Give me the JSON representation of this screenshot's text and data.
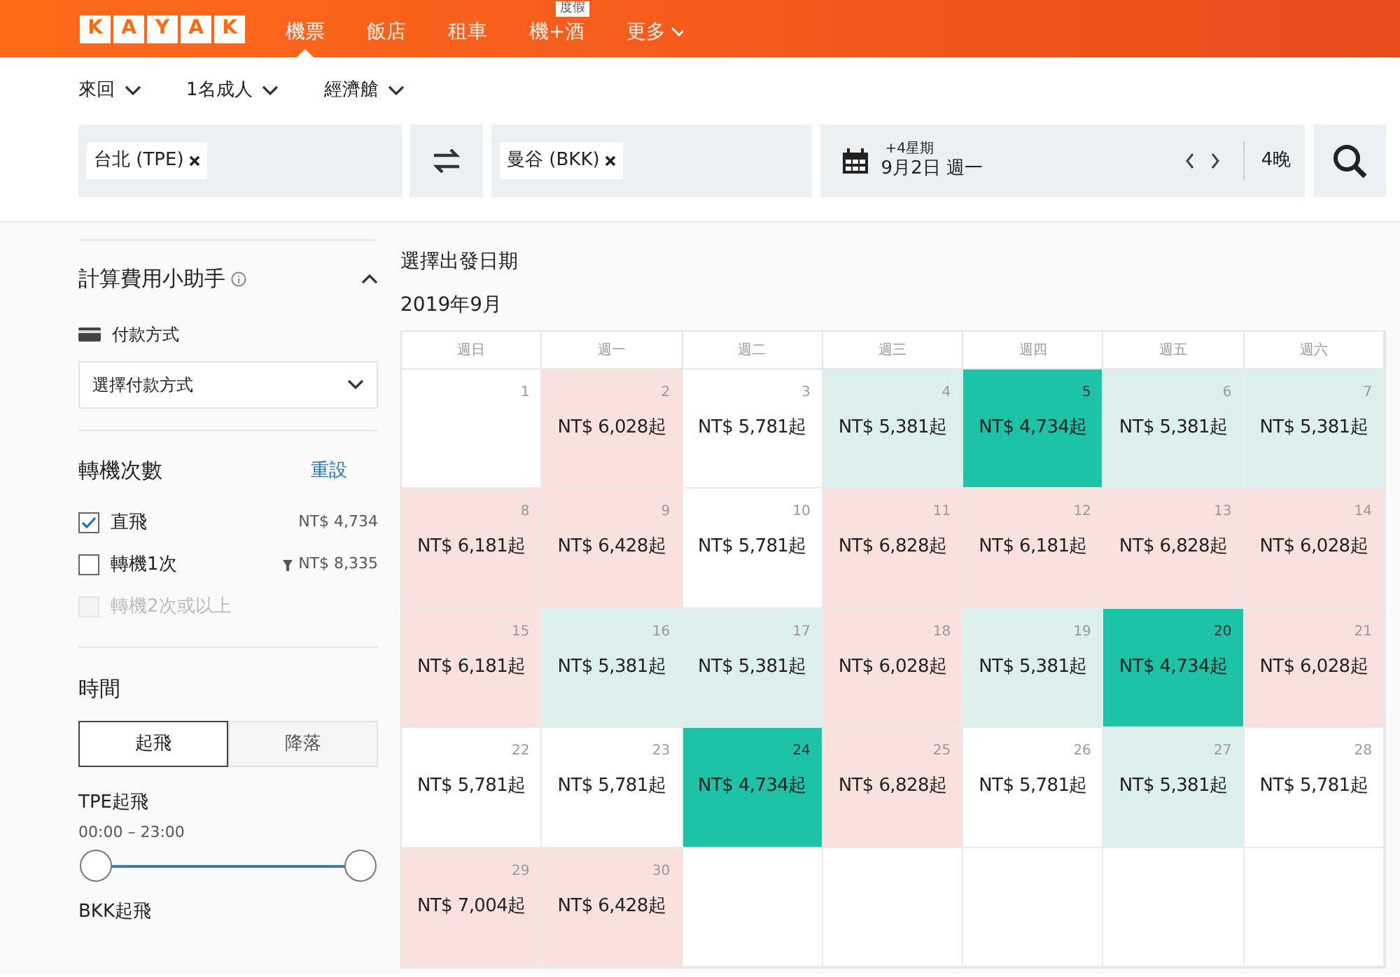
{
  "logo": [
    "K",
    "A",
    "Y",
    "A",
    "K"
  ],
  "nav": [
    {
      "label": "機票",
      "selected": true
    },
    {
      "label": "飯店",
      "selected": false
    },
    {
      "label": "租車",
      "selected": false
    },
    {
      "label": "機+酒",
      "selected": false,
      "badge": "度假"
    },
    {
      "label": "更多",
      "selected": false,
      "dropdown": true
    }
  ],
  "options": [
    "來回",
    "1名成人",
    "經濟艙"
  ],
  "search": {
    "origin": "台北 (TPE)",
    "destination": "曼谷 (BKK)",
    "date_hint": "+4星期",
    "date": "9月2日 週一",
    "nights": "4晚"
  },
  "sidebar": {
    "helper_title": "計算費用小助手",
    "payment_label": "付款方式",
    "payment_select": "選擇付款方式",
    "stops_title": "轉機次數",
    "reset": "重設",
    "stops": [
      {
        "label": "直飛",
        "price": "NT$ 4,734",
        "checked": true,
        "disabled": false,
        "filtered": false
      },
      {
        "label": "轉機1次",
        "price": "NT$ 8,335",
        "checked": false,
        "disabled": false,
        "filtered": true
      },
      {
        "label": "轉機2次或以上",
        "checked": false,
        "disabled": true,
        "filtered": false
      }
    ],
    "time_title": "時間",
    "time_tabs": [
      {
        "label": "起飛",
        "selected": true
      },
      {
        "label": "降落",
        "selected": false
      }
    ],
    "ranges": [
      {
        "label": "TPE起飛",
        "value": "00:00 – 23:00",
        "level": 1
      },
      {
        "label": "BKK起飛"
      }
    ]
  },
  "calendar": {
    "heading": "選擇出發日期",
    "month": "2019年9月",
    "weekdays": [
      "週日",
      "週一",
      "週二",
      "週三",
      "週四",
      "週五",
      "週六"
    ],
    "days": [
      {
        "day": "1"
      },
      {
        "day": "2",
        "price": "NT$ 6,028起",
        "kind": "high"
      },
      {
        "day": "3",
        "price": "NT$ 5,781起",
        "kind": "normal"
      },
      {
        "day": "4",
        "price": "NT$ 5,381起",
        "kind": "low"
      },
      {
        "day": "5",
        "price": "NT$ 4,734起",
        "kind": "lowest"
      },
      {
        "day": "6",
        "price": "NT$ 5,381起",
        "kind": "low"
      },
      {
        "day": "7",
        "price": "NT$ 5,381起",
        "kind": "low"
      },
      {
        "day": "8",
        "price": "NT$ 6,181起",
        "kind": "high"
      },
      {
        "day": "9",
        "price": "NT$ 6,428起",
        "kind": "high"
      },
      {
        "day": "10",
        "price": "NT$ 5,781起",
        "kind": "normal"
      },
      {
        "day": "11",
        "price": "NT$ 6,828起",
        "kind": "high"
      },
      {
        "day": "12",
        "price": "NT$ 6,181起",
        "kind": "high"
      },
      {
        "day": "13",
        "price": "NT$ 6,828起",
        "kind": "high"
      },
      {
        "day": "14",
        "price": "NT$ 6,028起",
        "kind": "high"
      },
      {
        "day": "15",
        "price": "NT$ 6,181起",
        "kind": "high"
      },
      {
        "day": "16",
        "price": "NT$ 5,381起",
        "kind": "low"
      },
      {
        "day": "17",
        "price": "NT$ 5,381起",
        "kind": "low"
      },
      {
        "day": "18",
        "price": "NT$ 6,028起",
        "kind": "high"
      },
      {
        "day": "19",
        "price": "NT$ 5,381起",
        "kind": "low"
      },
      {
        "day": "20",
        "price": "NT$ 4,734起",
        "kind": "lowest"
      },
      {
        "day": "21",
        "price": "NT$ 6,028起",
        "kind": "high"
      },
      {
        "day": "22",
        "price": "NT$ 5,781起",
        "kind": "normal"
      },
      {
        "day": "23",
        "price": "NT$ 5,781起",
        "kind": "normal"
      },
      {
        "day": "24",
        "price": "NT$ 4,734起",
        "kind": "lowest"
      },
      {
        "day": "25",
        "price": "NT$ 6,828起",
        "kind": "high"
      },
      {
        "day": "26",
        "price": "NT$ 5,781起",
        "kind": "normal"
      },
      {
        "day": "27",
        "price": "NT$ 5,381起",
        "kind": "low"
      },
      {
        "day": "28",
        "price": "NT$ 5,781起",
        "kind": "normal"
      },
      {
        "day": "29",
        "price": "NT$ 7,004起",
        "kind": "high"
      },
      {
        "day": "30",
        "price": "NT$ 6,428起",
        "kind": "high"
      }
    ]
  }
}
